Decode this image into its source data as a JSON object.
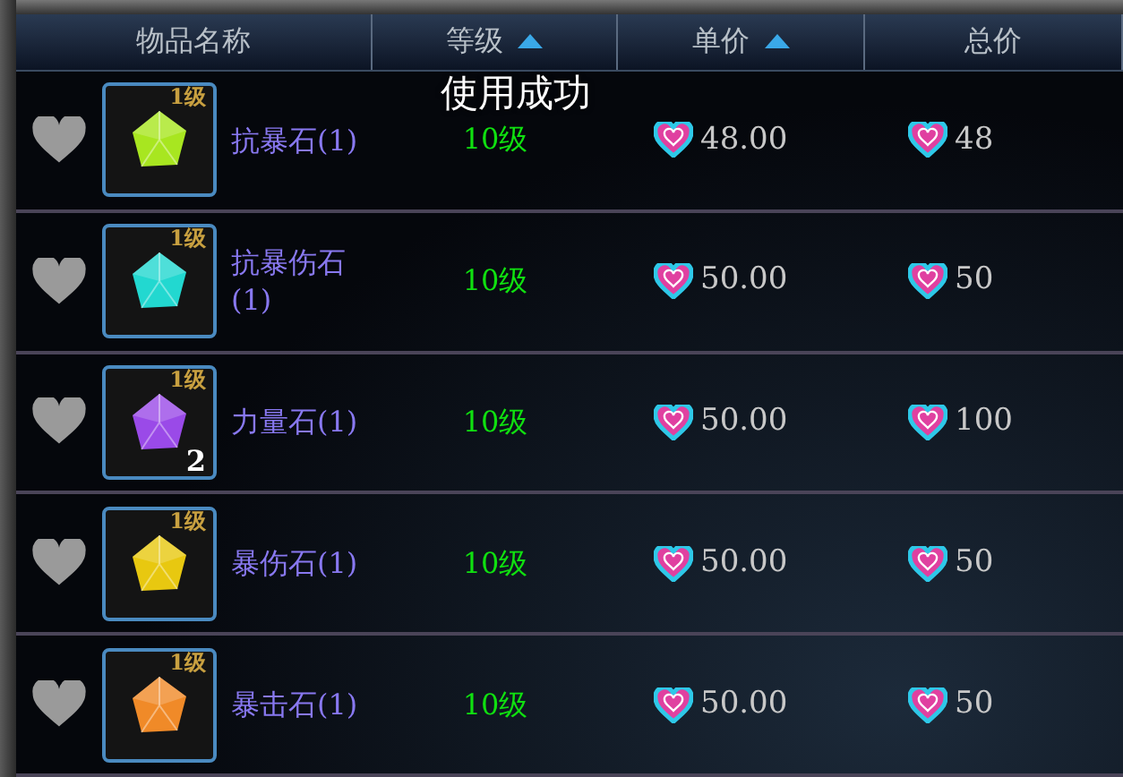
{
  "columns": [
    {
      "label": "物品名称",
      "sorted": false
    },
    {
      "label": "等级",
      "sorted": true
    },
    {
      "label": "单价",
      "sorted": true
    },
    {
      "label": "总价",
      "sorted": false
    }
  ],
  "toast": "使用成功",
  "rows": [
    {
      "favorite": false,
      "tier": "1级",
      "color": "#a8e620",
      "count": "",
      "name": "抗暴石(1)",
      "level": "10级",
      "price": "48.00",
      "total": "48"
    },
    {
      "favorite": false,
      "tier": "1级",
      "color": "#22d8d0",
      "count": "",
      "name": "抗暴伤石(1)",
      "level": "10级",
      "price": "50.00",
      "total": "50"
    },
    {
      "favorite": false,
      "tier": "1级",
      "color": "#9a4ae8",
      "count": "2",
      "name": "力量石(1)",
      "level": "10级",
      "price": "50.00",
      "total": "100"
    },
    {
      "favorite": false,
      "tier": "1级",
      "color": "#e8c810",
      "count": "",
      "name": "暴伤石(1)",
      "level": "10级",
      "price": "50.00",
      "total": "50"
    },
    {
      "favorite": false,
      "tier": "1级",
      "color": "#f08a28",
      "count": "",
      "name": "暴击石(1)",
      "level": "10级",
      "price": "50.00",
      "total": "50"
    }
  ]
}
